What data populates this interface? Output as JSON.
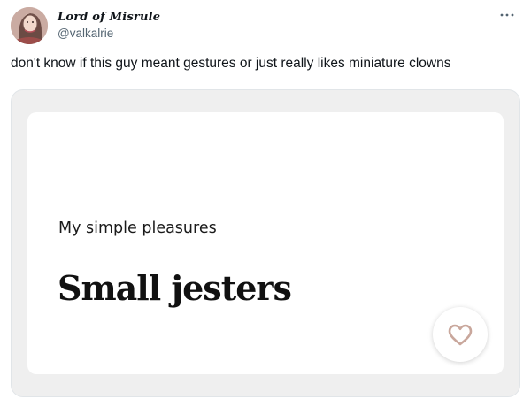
{
  "post": {
    "display_name": "Lord of Misrule",
    "handle": "@valkalrie",
    "more_icon": "more-icon",
    "text": "don't know if this guy meant gestures or just really likes miniature clowns"
  },
  "media": {
    "prompt": "My simple pleasures",
    "answer": "Small jesters",
    "like_icon": "heart-outline-icon",
    "colors": {
      "frame": "#efefef",
      "card": "#ffffff",
      "heart": "#c9a79c"
    }
  }
}
